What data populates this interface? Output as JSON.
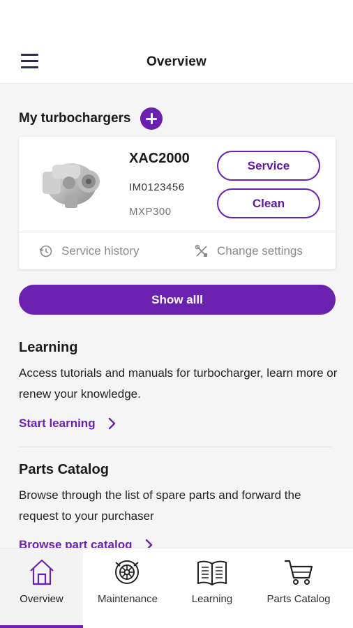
{
  "app_bar": {
    "title": "Overview"
  },
  "turbochargers": {
    "heading": "My turbochargers",
    "card": {
      "name": "XAC2000",
      "serial": "IM0123456",
      "model": "MXP300",
      "service_label": "Service",
      "clean_label": "Clean",
      "history_label": "Service history",
      "settings_label": "Change settings"
    },
    "show_all_label": "Show alll"
  },
  "learning": {
    "title": "Learning",
    "body": "Access tutorials and manuals for turbocharger, learn more or renew your knowledge.",
    "link": "Start learning"
  },
  "parts": {
    "title": "Parts Catalog",
    "body": "Browse through the list of spare parts and forward the request to your purchaser",
    "link": "Browse part catalog"
  },
  "bottom_nav": {
    "items": [
      {
        "label": "Overview",
        "icon": "home-icon",
        "active": true
      },
      {
        "label": "Maintenance",
        "icon": "turbine-icon",
        "active": false
      },
      {
        "label": "Learning",
        "icon": "book-icon",
        "active": false
      },
      {
        "label": "Parts Catalog",
        "icon": "cart-icon",
        "active": false
      }
    ]
  },
  "colors": {
    "accent": "#6b21b0",
    "background": "#f5f5f5",
    "surface": "#ffffff"
  }
}
